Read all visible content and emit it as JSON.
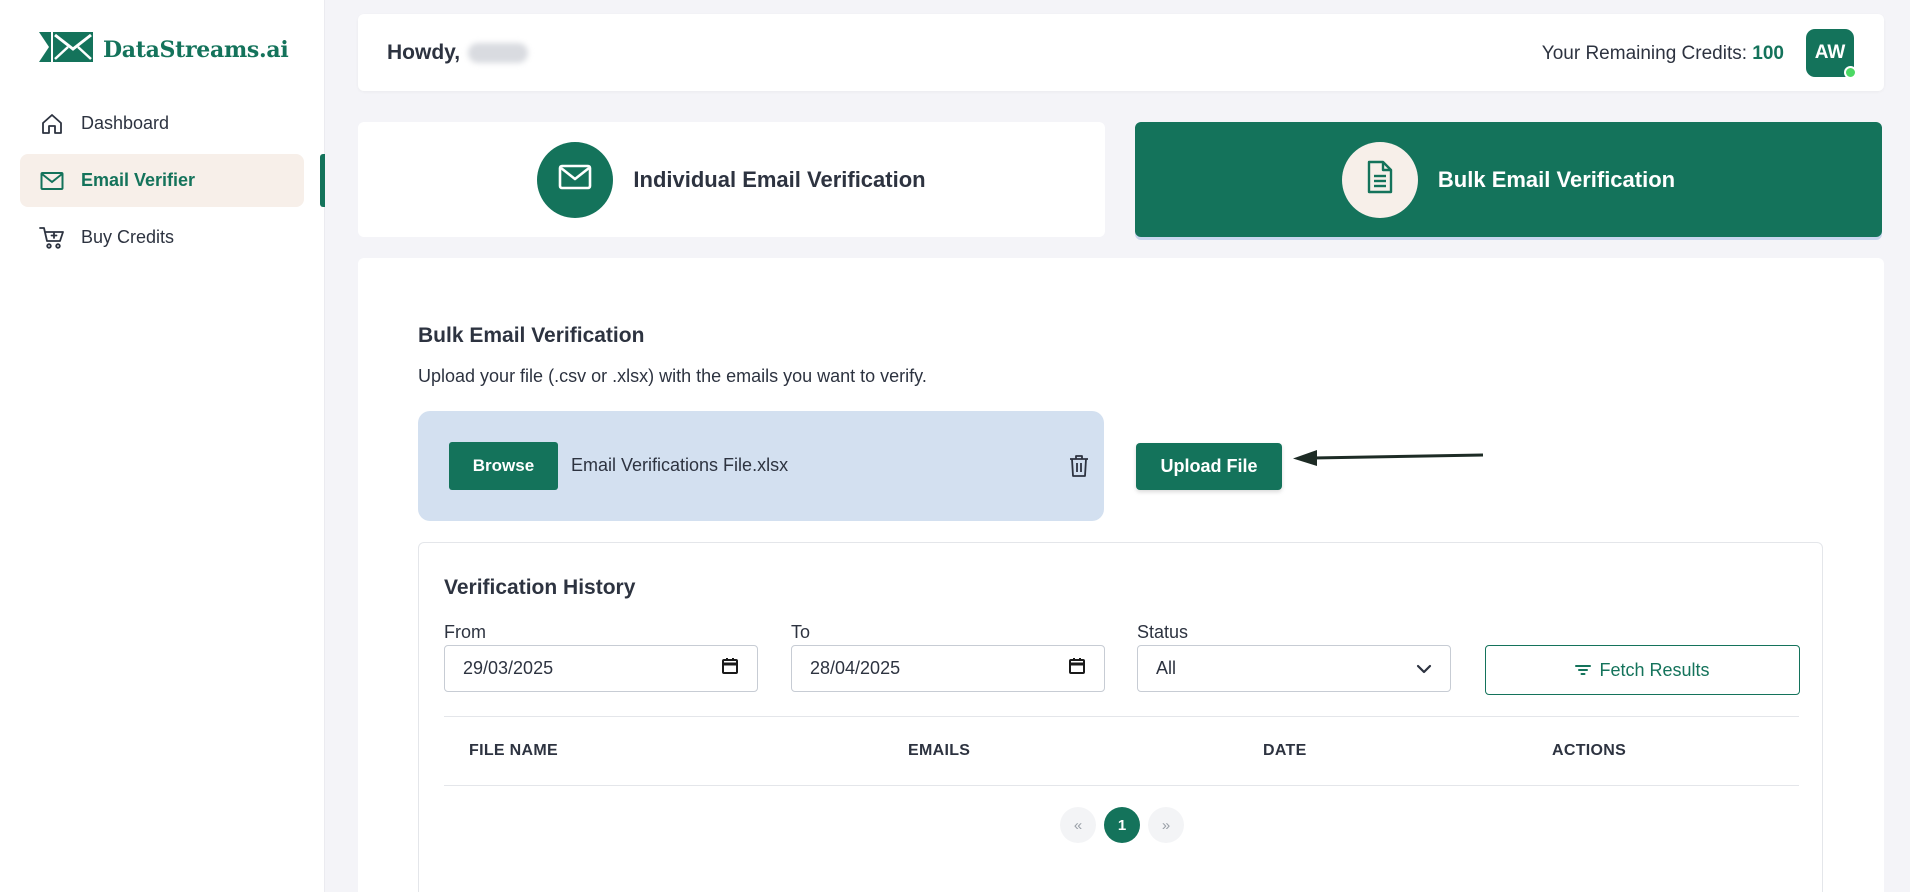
{
  "app": {
    "logo_text": "DataStreams.ai",
    "accent_color": "#14735b"
  },
  "sidebar": {
    "items": [
      {
        "label": "Dashboard",
        "icon": "home-icon",
        "active": false
      },
      {
        "label": "Email Verifier",
        "icon": "mail-icon",
        "active": true
      },
      {
        "label": "Buy Credits",
        "icon": "cart-icon",
        "active": false
      }
    ]
  },
  "header": {
    "greeting": "Howdy,",
    "credits_label": "Your Remaining Credits:",
    "credits_value": "100",
    "avatar_initials": "AW"
  },
  "modes": {
    "individual_label": "Individual Email Verification",
    "bulk_label": "Bulk Email Verification"
  },
  "bulk": {
    "title": "Bulk Email Verification",
    "subtitle": "Upload your file (.csv or .xlsx) with the emails you want to verify.",
    "browse_label": "Browse",
    "file_name": "Email Verifications File.xlsx",
    "upload_label": "Upload File"
  },
  "history": {
    "title": "Verification History",
    "from_label": "From",
    "from_value": "29/03/2025",
    "to_label": "To",
    "to_value": "28/04/2025",
    "status_label": "Status",
    "status_value": "All",
    "fetch_label": "Fetch Results",
    "columns": [
      "FILE NAME",
      "EMAILS",
      "DATE",
      "ACTIONS"
    ],
    "pagination": {
      "prev": "«",
      "current": "1",
      "next": "»"
    }
  }
}
